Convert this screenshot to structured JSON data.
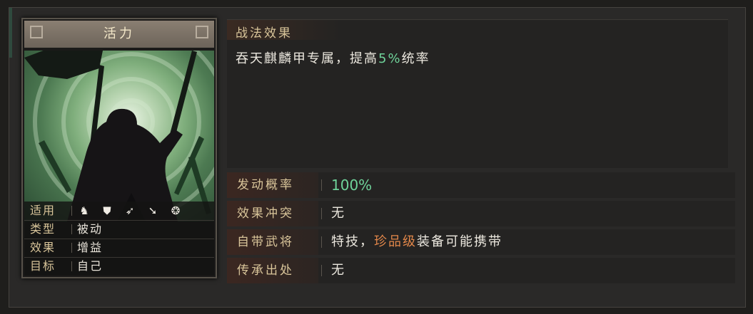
{
  "card": {
    "title": "活力",
    "info": [
      {
        "label": "适用",
        "value": ""
      },
      {
        "label": "类型",
        "value": "被动"
      },
      {
        "label": "效果",
        "value": "增益"
      },
      {
        "label": "目标",
        "value": "自己"
      }
    ],
    "unit_icons": [
      "cavalry-icon",
      "shield-infantry-icon",
      "archer-icon",
      "spear-icon",
      "siege-wheel-icon"
    ]
  },
  "effect": {
    "title": "战法效果",
    "desc_prefix": "吞天麒麟甲专属，提高",
    "desc_value": "5%",
    "desc_suffix": "统率"
  },
  "props": [
    {
      "label": "发动概率",
      "value": "100%"
    },
    {
      "label": "效果冲突",
      "value": "无"
    },
    {
      "label": "自带武将",
      "value_prefix": "特技，",
      "value_highlight": "珍品级",
      "value_suffix": "装备可能携带"
    },
    {
      "label": "传承出处",
      "value": "无"
    }
  ],
  "colors": {
    "label_gold": "#d9c59a",
    "highlight_green": "#6fd39a",
    "highlight_orange": "#e2874a"
  }
}
